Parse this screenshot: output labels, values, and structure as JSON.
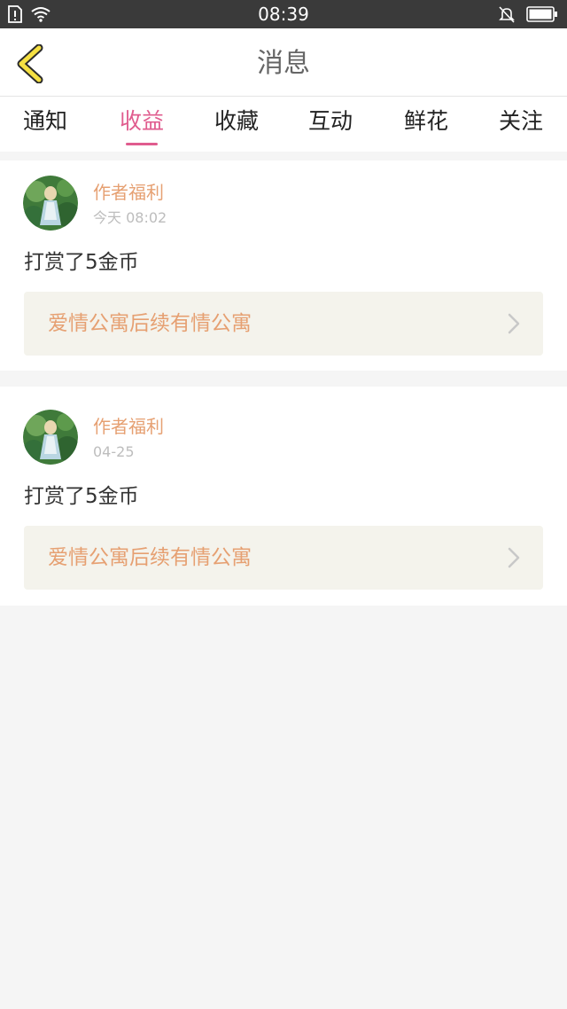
{
  "status_bar": {
    "time": "08:39",
    "icons": [
      "sim-alert-icon",
      "wifi-icon",
      "silent-bell-icon",
      "battery-icon"
    ]
  },
  "header": {
    "title": "消息",
    "back_icon": "back-chevron-icon"
  },
  "tabs": [
    {
      "label": "通知",
      "active": false
    },
    {
      "label": "收益",
      "active": true
    },
    {
      "label": "收藏",
      "active": false
    },
    {
      "label": "互动",
      "active": false
    },
    {
      "label": "鲜花",
      "active": false
    },
    {
      "label": "关注",
      "active": false
    }
  ],
  "messages": [
    {
      "author": "作者福利",
      "time": "今天 08:02",
      "text": "打赏了5金币",
      "link": "爱情公寓后续有情公寓"
    },
    {
      "author": "作者福利",
      "time": "04-25",
      "text": "打赏了5金币",
      "link": "爱情公寓后续有情公寓"
    }
  ],
  "colors": {
    "accent": "#e05c8e",
    "author": "#e6a072",
    "link_bg": "#f4f3ec",
    "back_chevron": "#f5e042"
  }
}
